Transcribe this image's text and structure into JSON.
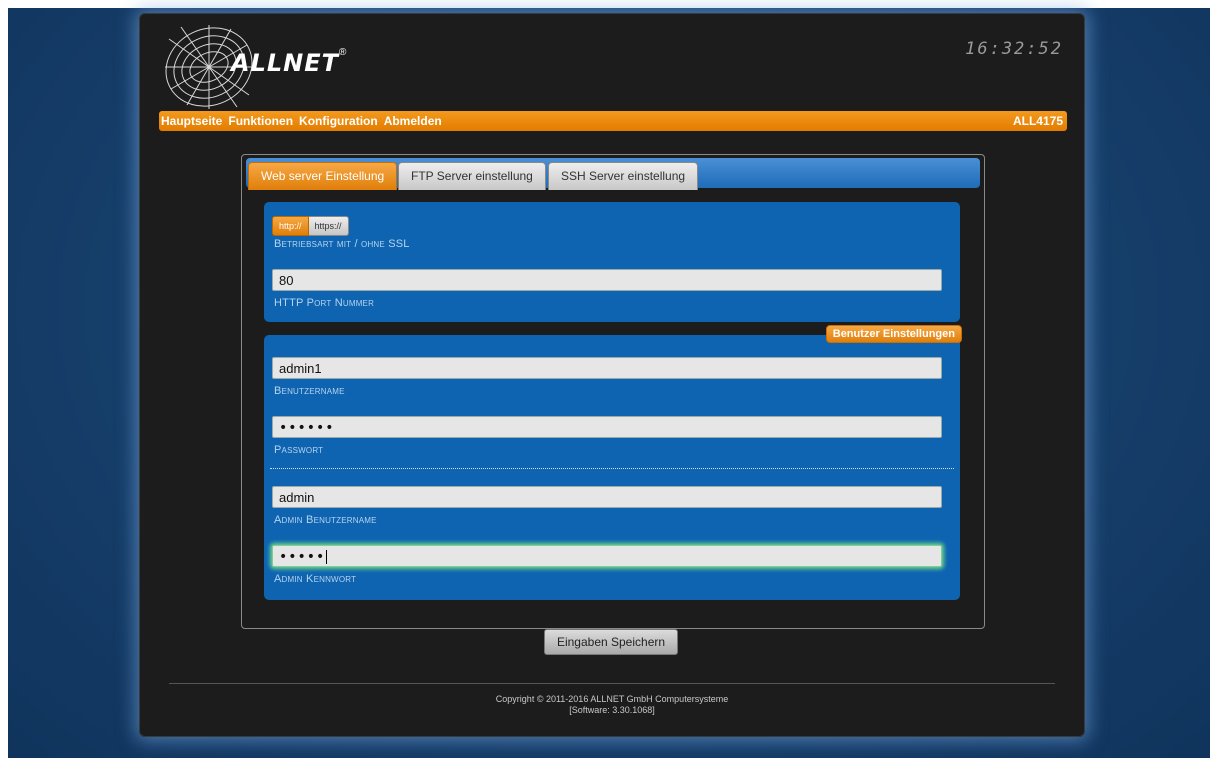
{
  "header": {
    "brand": "ALLNET",
    "registered_mark": "®",
    "clock": "16:32:52"
  },
  "nav": {
    "items": [
      "Hauptseite",
      "Funktionen",
      "Konfiguration",
      "Abmelden"
    ],
    "device": "ALL4175"
  },
  "tabs": [
    {
      "label": "Web server Einstellung",
      "active": true
    },
    {
      "label": "FTP Server einstellung",
      "active": false
    },
    {
      "label": "SSH Server einstellung",
      "active": false
    }
  ],
  "ssl": {
    "http_label": "http://",
    "https_label": "https://",
    "selected": "http://",
    "caption": "Betriebsart mit / ohne SSL"
  },
  "port": {
    "value": "80",
    "label": "HTTP Port Nummer"
  },
  "user_settings": {
    "badge": "Benutzer Einstellungen",
    "username_value": "admin1",
    "username_label": "Benutzername",
    "password_value": "••••••",
    "password_label": "Passwort",
    "admin_username_value": "admin",
    "admin_username_label": "Admin Benutzername",
    "admin_password_value": "•••••",
    "admin_password_label": "Admin Kennwort"
  },
  "actions": {
    "save_label": "Eingaben Speichern"
  },
  "footer": {
    "copyright": "Copyright © 2011-2016 ALLNET GmbH Computersysteme",
    "software": "[Software: 3.30.1068]"
  },
  "colors": {
    "accent_orange": "#e88a10",
    "panel_blue": "#0e64b0",
    "background_blue": "#163f6b"
  }
}
